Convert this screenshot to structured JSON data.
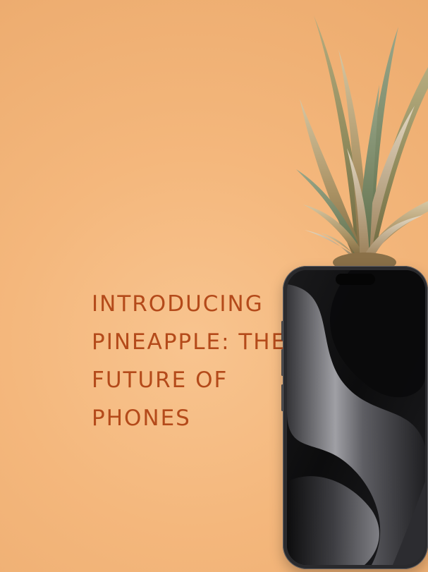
{
  "headline": {
    "lines": [
      "INTRODUCING",
      "PINEAPPLE: THE",
      "FUTURE OF",
      "PHONES"
    ]
  },
  "colors": {
    "background": "#f4b77c",
    "headline": "#b44a1a",
    "phone_frame": "#2a2a2d"
  },
  "image": {
    "subject": "pineapple-phone",
    "crown": "pineapple-crown-icon",
    "device": "smartphone-icon"
  }
}
